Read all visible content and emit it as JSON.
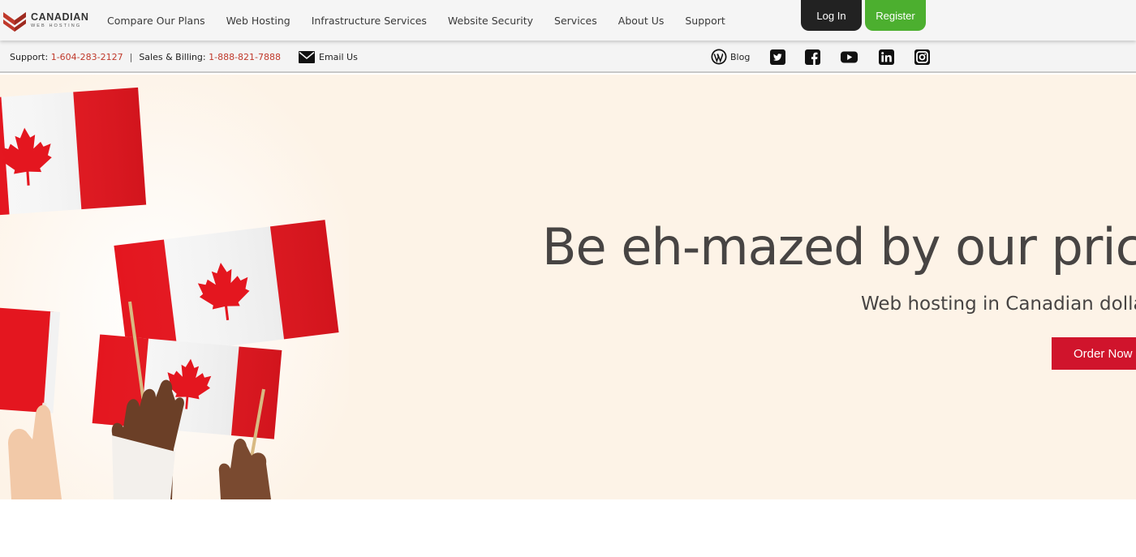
{
  "brand": {
    "name": "CANADIAN",
    "tagline": "WEB HOSTING",
    "accent_color": "#c0392b"
  },
  "nav": {
    "items": [
      {
        "label": "Compare Our Plans"
      },
      {
        "label": "Web Hosting"
      },
      {
        "label": "Infrastructure Services"
      },
      {
        "label": "Website Security"
      },
      {
        "label": "Services"
      },
      {
        "label": "About Us"
      },
      {
        "label": "Support"
      }
    ],
    "login_label": "Log In",
    "register_label": "Register",
    "login_color": "#222222",
    "register_color": "#4caf2f"
  },
  "infobar": {
    "support_label": "Support:",
    "support_phone": "1-604-283-2127",
    "separator": "|",
    "sales_label": "Sales & Billing:",
    "sales_phone": "1-888-821-7888",
    "email_label": "Email Us",
    "blog_label": "Blog",
    "social_icons": [
      "twitter-icon",
      "facebook-icon",
      "youtube-icon",
      "linkedin-icon",
      "instagram-icon"
    ]
  },
  "hero": {
    "title": "Be eh-mazed by our prices",
    "subtitle": "Web hosting in Canadian dollars",
    "cta_label": "Order Now",
    "cta_color": "#d0142c",
    "background_color": "#fdf3e7"
  }
}
